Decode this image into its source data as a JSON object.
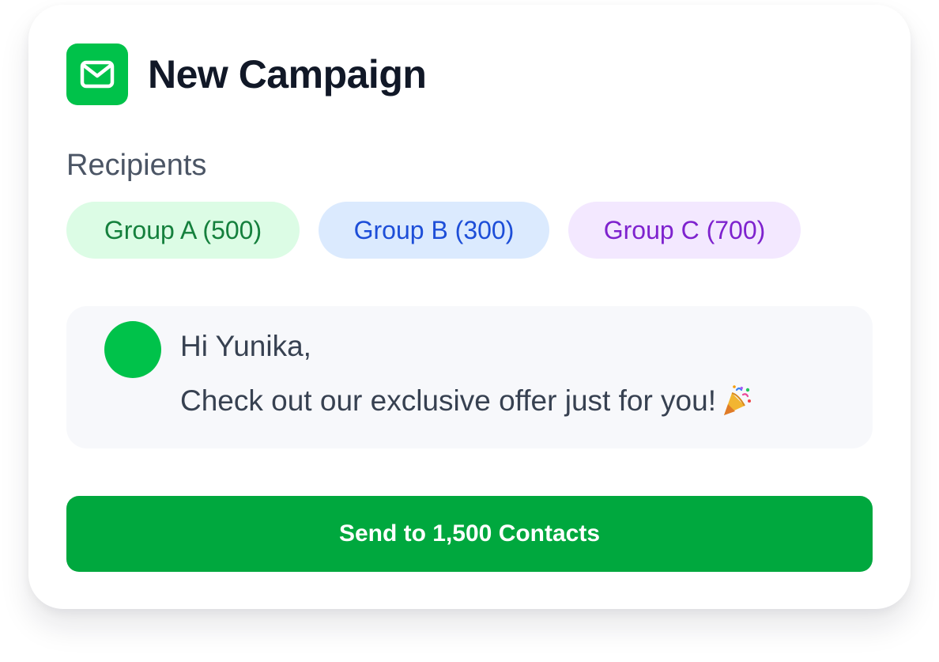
{
  "campaign": {
    "title": "New Campaign",
    "icon": "mail-icon",
    "accent_color": "#00c24a"
  },
  "recipients": {
    "label": "Recipients",
    "groups": [
      {
        "label": "Group A (500)",
        "bg": "#dcfce5",
        "color": "#15803d"
      },
      {
        "label": "Group B (300)",
        "bg": "#dbeafe",
        "color": "#1d4ed8"
      },
      {
        "label": "Group C (700)",
        "bg": "#f3e8ff",
        "color": "#7e22ce"
      }
    ]
  },
  "message": {
    "greeting": "Hi Yunika,",
    "body": "Check out our exclusive offer just for you!",
    "emoji_icon": "party-popper-icon"
  },
  "send_button": {
    "label": "Send to 1,500 Contacts",
    "color": "#00a83e"
  }
}
